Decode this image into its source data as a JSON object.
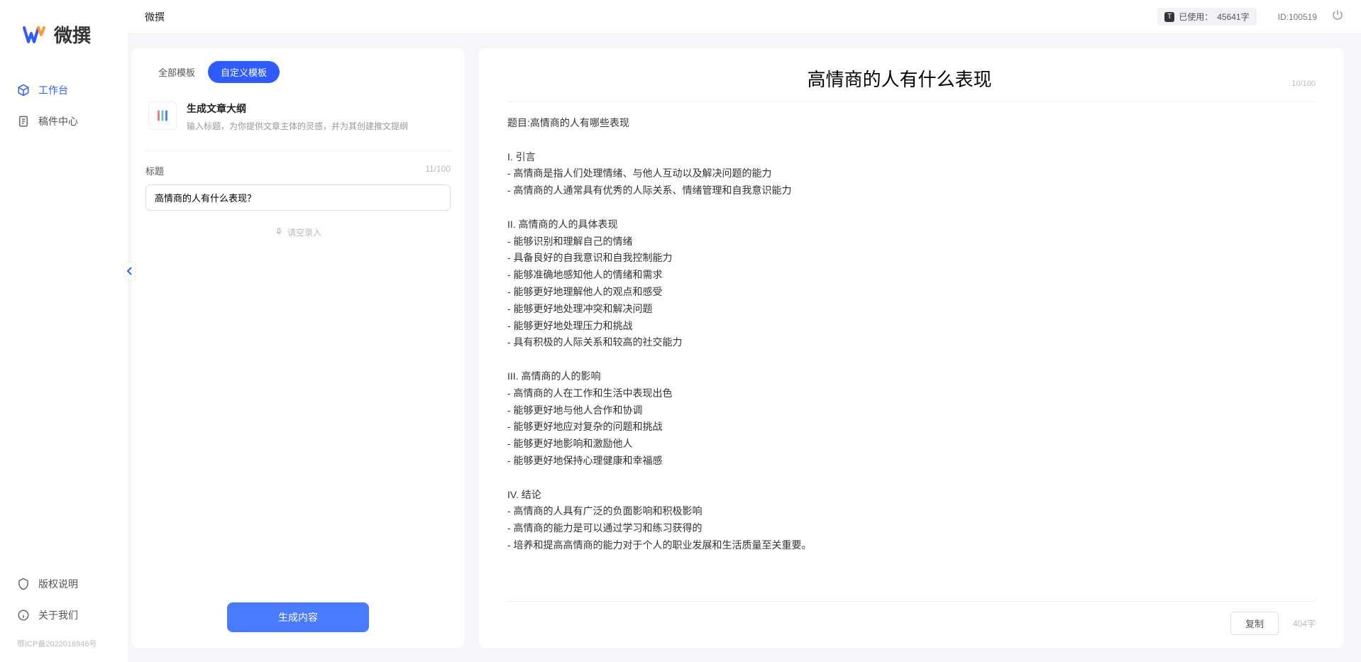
{
  "app": {
    "name": "微撰",
    "logo_name": "微撰"
  },
  "sidebar": {
    "items": [
      {
        "label": "工作台",
        "icon": "cube"
      },
      {
        "label": "稿件中心",
        "icon": "doc"
      }
    ],
    "bottom": [
      {
        "label": "版权说明",
        "icon": "shield"
      },
      {
        "label": "关于我们",
        "icon": "info"
      }
    ],
    "icp": "鄂ICP备2022016946号"
  },
  "topbar": {
    "title": "微撰",
    "usage_prefix": "已使用：",
    "usage_value": "45641字",
    "id_label": "ID:100519"
  },
  "left_panel": {
    "tabs": [
      "全部模板",
      "自定义模板"
    ],
    "active_tab": 1,
    "template": {
      "title": "生成文章大纲",
      "desc": "输入标题，为你提供文章主体的灵感，并为其创建推文提纲"
    },
    "field_label": "标题",
    "field_count": "11/100",
    "input_value": "高情商的人有什么表现？",
    "voice_hint": "请空录入",
    "generate_btn": "生成内容"
  },
  "right_panel": {
    "title": "高情商的人有什么表现",
    "title_count": "10/100",
    "body": "题目:高情商的人有哪些表现\n\nI. 引言\n- 高情商是指人们处理情绪、与他人互动以及解决问题的能力\n- 高情商的人通常具有优秀的人际关系、情绪管理和自我意识能力\n\nII. 高情商的人的具体表现\n- 能够识别和理解自己的情绪\n- 具备良好的自我意识和自我控制能力\n- 能够准确地感知他人的情绪和需求\n- 能够更好地理解他人的观点和感受\n- 能够更好地处理冲突和解决问题\n- 能够更好地处理压力和挑战\n- 具有积极的人际关系和较高的社交能力\n\nIII. 高情商的人的影响\n- 高情商的人在工作和生活中表现出色\n- 能够更好地与他人合作和协调\n- 能够更好地应对复杂的问题和挑战\n- 能够更好地影响和激励他人\n- 能够更好地保持心理健康和幸福感\n\nIV. 结论\n- 高情商的人具有广泛的负面影响和积极影响\n- 高情商的能力是可以通过学习和练习获得的\n- 培养和提高高情商的能力对于个人的职业发展和生活质量至关重要。",
    "copy_btn": "复制",
    "word_count": "404字"
  }
}
